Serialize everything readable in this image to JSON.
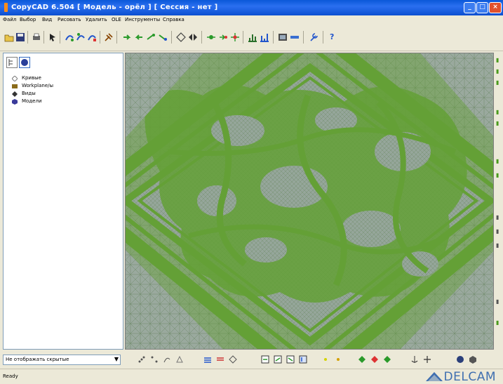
{
  "window": {
    "title": "CopyCAD 6.504    [ Модель -  орёл  ] [ Сессия - нет ]",
    "minimize_glyph": "_",
    "maximize_glyph": "□",
    "close_glyph": "×"
  },
  "menu": [
    "Файл",
    "Выбор",
    "Вид",
    "Рисовать",
    "Удалить",
    "OLE",
    "Инструменты",
    "Справка"
  ],
  "toolbar": {
    "buttons": [
      "open-icon",
      "save-icon",
      "print-icon",
      "pointer-icon",
      "curve-icon-1",
      "curve-icon-2",
      "curve-icon-3",
      "tools-icon",
      "arrow-icon-1",
      "arrow-icon-2",
      "arrow-icon-3",
      "arrow-icon-4",
      "diamond-icon",
      "mirror-icon",
      "point-icon-1",
      "point-icon-2",
      "point-icon-3",
      "chart-icon-1",
      "chart-icon-2",
      "shade-icon",
      "plane-icon",
      "tool-icon",
      "help-icon"
    ],
    "help_label": "?"
  },
  "tree": {
    "items": [
      {
        "label": "Кривые",
        "icon": "curves-icon",
        "color": "#7a7a7a"
      },
      {
        "label": "Workplane/ы",
        "icon": "workplane-icon",
        "color": "#8a6b1a"
      },
      {
        "label": "Виды",
        "icon": "views-icon",
        "color": "#333333"
      },
      {
        "label": "Модели",
        "icon": "models-icon",
        "color": "#3a3a9a"
      }
    ]
  },
  "bottom_toolbar": {
    "combo_value": "Не отображать скрытые",
    "combo_arrow": "▼"
  },
  "status": {
    "text": "Ready",
    "brand": "DELCAM"
  },
  "colors": {
    "mesh_green": "#64a036",
    "mesh_line": "#8fa39a",
    "brand_blue": "#3f6fb0"
  }
}
